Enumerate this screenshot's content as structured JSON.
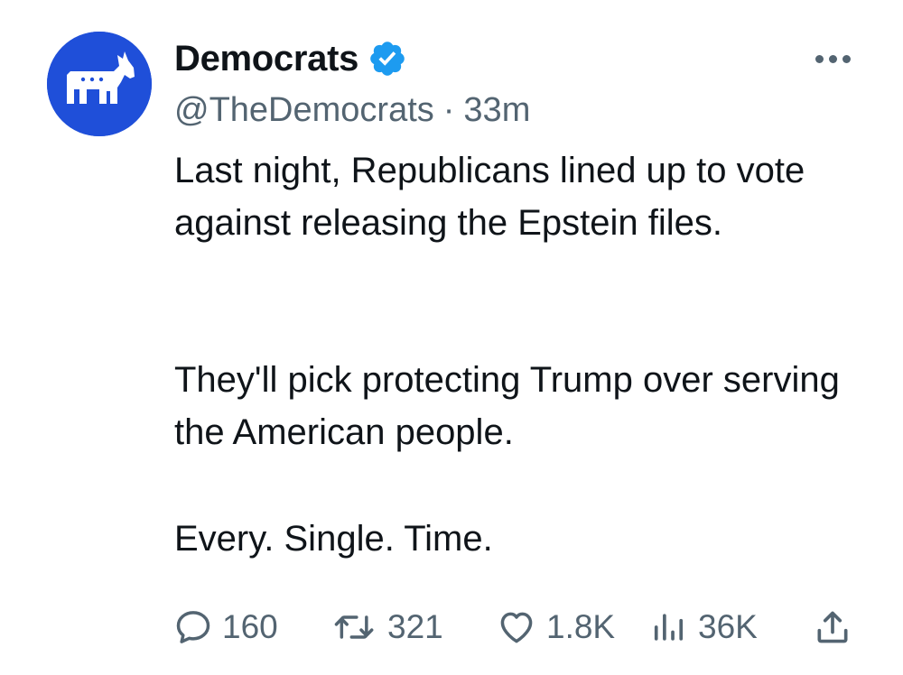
{
  "account": {
    "display_name": "Democrats",
    "handle": "@TheDemocrats",
    "separator": "·",
    "time_ago": "33m",
    "verified": true,
    "avatar_color": "#1f4fd9"
  },
  "tweet": {
    "paragraph_1": "Last night, Republicans lined up to vote against releasing the Epstein files.",
    "paragraph_2": "They'll pick protecting Trump over serving the American people.",
    "paragraph_3": "Every. Single. Time."
  },
  "actions": {
    "replies": "160",
    "retweets": "321",
    "likes": "1.8K",
    "views": "36K"
  },
  "icons": {
    "avatar": "donkey-logo-icon",
    "verified": "verified-badge-icon",
    "more": "more-options-icon",
    "reply": "reply-icon",
    "retweet": "retweet-icon",
    "like": "heart-icon",
    "views": "views-chart-icon",
    "share": "share-icon"
  },
  "colors": {
    "text": "#0f1419",
    "secondary_text": "#536471",
    "verified_blue": "#1d9bf0"
  }
}
